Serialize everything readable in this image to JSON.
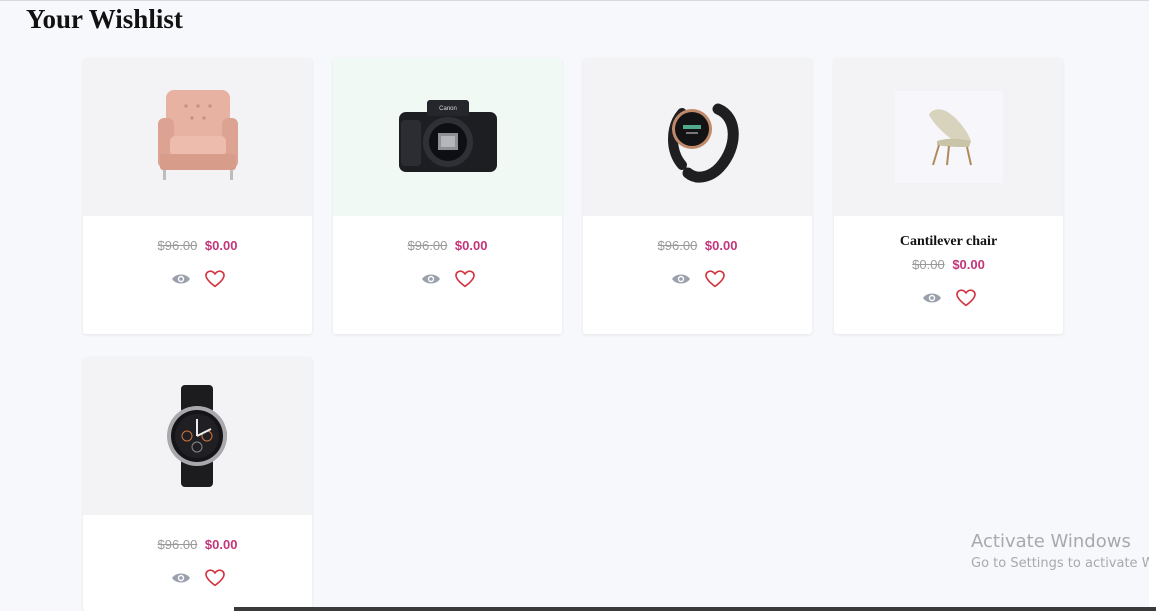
{
  "page": {
    "title": "Your Wishlist"
  },
  "products": [
    {
      "name": "",
      "old_price": "$96.00",
      "price": "$0.00",
      "image": "armchair-image"
    },
    {
      "name": "",
      "old_price": "$96.00",
      "price": "$0.00",
      "image": "camera-image"
    },
    {
      "name": "",
      "old_price": "$96.00",
      "price": "$0.00",
      "image": "fitness-band-image"
    },
    {
      "name": "Cantilever chair",
      "old_price": "$0.00",
      "price": "$0.00",
      "image": "lounge-chair-image"
    },
    {
      "name": "",
      "old_price": "$96.00",
      "price": "$0.00",
      "image": "smartwatch-image"
    }
  ],
  "actions": {
    "view_icon": "eye-icon",
    "wishlist_icon": "heart-icon"
  },
  "colors": {
    "price": "#c2367a",
    "heart": "#d2333f",
    "eye": "#9aa1ac"
  },
  "watermark": {
    "title": "Activate Windows",
    "subtitle": "Go to Settings to activate Windows."
  }
}
